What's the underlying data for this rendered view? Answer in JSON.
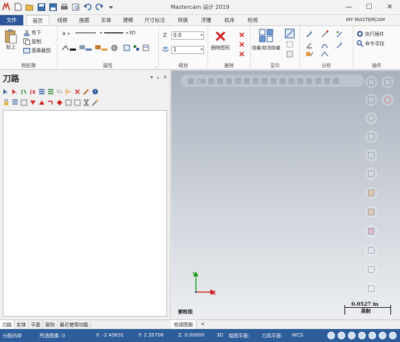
{
  "window": {
    "title": "Mastercam 设计 2019",
    "minimize": "—",
    "maximize": "☐",
    "close": "✕"
  },
  "tabs": {
    "file": "文件",
    "home": "首页",
    "wireframe": "线框",
    "surfaces": "曲面",
    "solids": "实体",
    "modeling": "建模",
    "drafting": "尺寸标注",
    "transform": "转换",
    "relief": "浮雕",
    "machine": "机床",
    "view": "检视",
    "my_mastercam": "MY MASTERCAM"
  },
  "ribbon": {
    "clipboard": {
      "label": "剪贴簿",
      "paste": "贴上",
      "cut": "剪下",
      "copy": "复制",
      "screenshot": "萤幕截图"
    },
    "attributes": {
      "label": "属性",
      "mode_3d": "3D"
    },
    "organize": {
      "label": "规划",
      "z_label": "Z",
      "z_value": "0.0",
      "level_value": "1"
    },
    "delete": {
      "label": "删除",
      "delete_entities": "删除图形"
    },
    "display": {
      "label": "显示",
      "hide_unhide": "隐藏/取消隐藏"
    },
    "analyze": {
      "label": "分析"
    },
    "addins": {
      "label": "插件",
      "run_addin": "执行插件",
      "command_finder": "命令寻找"
    }
  },
  "panel": {
    "title": "刀路",
    "pin": "▾",
    "autohide": "ᵩ",
    "close": "✕",
    "tabs": [
      "刀路",
      "实体",
      "平面",
      "层别",
      "最近使用功能"
    ]
  },
  "viewport": {
    "toolbar_text": "刀路",
    "axis_z": "Y",
    "axis_x": "X",
    "view_name": "俯检视",
    "scale_value": "0.0527 in",
    "scale_unit": "英制",
    "tab": "检视图板",
    "tab_close": "✕"
  },
  "statusbar": {
    "section_view": "分配内存",
    "selected": "所选图素: 0",
    "x": "X:   -2.45631",
    "y": "Y:   2.35706",
    "z": "Z:   0.00000",
    "mode": "3D",
    "gplane": "绘图平面:",
    "tplane": "刀具平面:",
    "wcs": "WCS:"
  },
  "colors": {
    "file_tab": "#2b579a",
    "statusbar": "#2d5d9a",
    "axis_x": "#d02020",
    "axis_y": "#1a9c1a"
  }
}
